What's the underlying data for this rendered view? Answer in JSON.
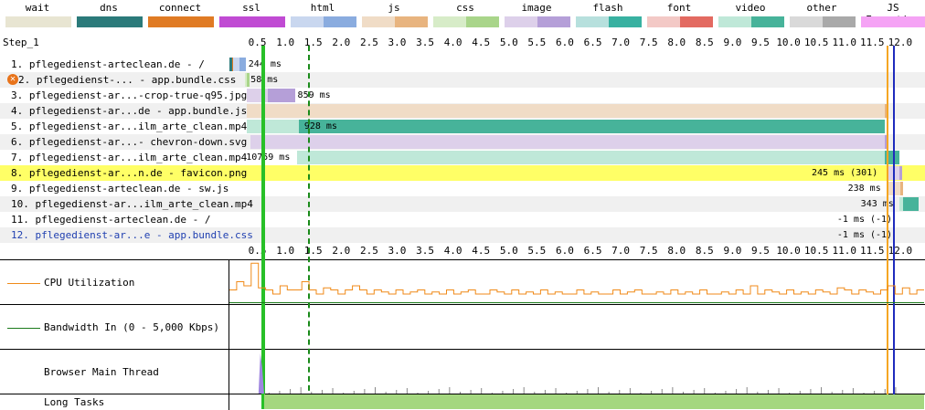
{
  "legend": [
    {
      "label": "wait",
      "c1": "#e8e5d2",
      "c2": "#e8e5d2"
    },
    {
      "label": "dns",
      "c1": "#2b7a7a",
      "c2": "#2b7a7a"
    },
    {
      "label": "connect",
      "c1": "#e07b24",
      "c2": "#e07b24"
    },
    {
      "label": "ssl",
      "c1": "#c04bd3",
      "c2": "#c04bd3"
    },
    {
      "label": "html",
      "c1": "#c9d7ef",
      "c2": "#8aacdf"
    },
    {
      "label": "js",
      "c1": "#f0dcc6",
      "c2": "#e8b47f"
    },
    {
      "label": "css",
      "c1": "#d7ecc8",
      "c2": "#a9d58a"
    },
    {
      "label": "image",
      "c1": "#ddd0ea",
      "c2": "#b59fd8"
    },
    {
      "label": "flash",
      "c1": "#b7e0dd",
      "c2": "#38b1a1"
    },
    {
      "label": "font",
      "c1": "#f3c9c6",
      "c2": "#e36a61"
    },
    {
      "label": "video",
      "c1": "#bfe8d8",
      "c2": "#47b39a"
    },
    {
      "label": "other",
      "c1": "#d9d9d9",
      "c2": "#a9a9a9"
    },
    {
      "label": "JS Execution",
      "c1": "#f5a3f5",
      "c2": "#f5a3f5"
    }
  ],
  "step_label": "Step_1",
  "chart_data": {
    "type": "waterfall",
    "xlim": [
      0,
      12.1
    ],
    "x_ticks": [
      "0.5",
      "1.0",
      "1.5",
      "2.0",
      "2.5",
      "3.0",
      "3.5",
      "4.0",
      "4.5",
      "5.0",
      "5.5",
      "6.0",
      "6.5",
      "7.0",
      "7.5",
      "8.0",
      "8.5",
      "9.0",
      "9.5",
      "10.0",
      "10.5",
      "11.0",
      "11.5",
      "12.0"
    ],
    "requests": [
      {
        "label": "1. pflegedienst-arteclean.de - /",
        "start": 0.06,
        "ttfb_end": 0.18,
        "end": 0.29,
        "c1": "#c9d7ef",
        "c2": "#8aacdf",
        "pre": [
          {
            "s": 0.0,
            "e": 0.05,
            "c": "#2b7a7a"
          },
          {
            "s": 0.05,
            "e": 0.1,
            "c": "#e07b24"
          },
          {
            "s": 0.1,
            "e": 0.16,
            "c": "#c04bd3"
          }
        ],
        "ms": "244 ms",
        "ms_side": "right",
        "blue": false,
        "highlight": false,
        "error": false
      },
      {
        "label": "2. pflegedienst-... - app.bundle.css",
        "start": 0.27,
        "ttfb_end": 0.31,
        "end": 0.33,
        "c1": "#d7ecc8",
        "c2": "#a9d58a",
        "pre": [],
        "ms": "58 ms",
        "ms_side": "right",
        "blue": false,
        "highlight": false,
        "error": true
      },
      {
        "label": "3. pflegedienst-ar...-crop-true-q95.jpg",
        "start": 0.31,
        "ttfb_end": 0.68,
        "end": 1.17,
        "c1": "#ddd0ea",
        "c2": "#b59fd8",
        "pre": [],
        "ms": "859 ms",
        "ms_side": "right",
        "blue": false,
        "highlight": false,
        "error": false
      },
      {
        "label": "4. pflegedienst-ar...de - app.bundle.js",
        "start": 0.31,
        "ttfb_end": 11.73,
        "end": 11.73,
        "c1": "#f0dcc6",
        "c2": "#e8b47f",
        "pre": [],
        "ms": "",
        "ms_side": "none",
        "blue": false,
        "highlight": false,
        "error": false
      },
      {
        "label": "5. pflegedienst-ar...ilm_arte_clean.mp4",
        "start": 0.31,
        "ttfb_end": 1.24,
        "end": 11.73,
        "c1": "#bfe8d8",
        "c2": "#47b39a",
        "pre": [],
        "ms": "928 ms",
        "ms_side": "inside",
        "blue": false,
        "highlight": false,
        "error": false
      },
      {
        "label": "6. pflegedienst-ar...- chevron-down.svg",
        "start": 0.38,
        "ttfb_end": 11.73,
        "end": 11.73,
        "c1": "#ddd0ea",
        "c2": "#b59fd8",
        "pre": [],
        "ms": "",
        "ms_side": "none",
        "blue": false,
        "highlight": false,
        "error": false
      },
      {
        "label": "7. pflegedienst-ar...ilm_arte_clean.mp4",
        "start": 1.21,
        "ttfb_end": 11.73,
        "end": 11.99,
        "c1": "#bfe8d8",
        "c2": "#47b39a",
        "pre": [],
        "ms": "10759 ms",
        "ms_side": "left",
        "blue": false,
        "highlight": false,
        "error": false
      },
      {
        "label": "8. pflegedienst-ar...n.de - favicon.png",
        "start": 11.76,
        "ttfb_end": 11.99,
        "end": 11.99,
        "c1": "#ddd0ea",
        "c2": "#b59fd8",
        "pre": [],
        "ms": "245 ms (301)",
        "ms_side": "left",
        "blue": false,
        "highlight": true,
        "error": false
      },
      {
        "label": "9. pflegedienst-arteclean.de - sw.js",
        "start": 11.76,
        "ttfb_end": 12.0,
        "end": 12.0,
        "c1": "#f0dcc6",
        "c2": "#e8b47f",
        "pre": [],
        "ms": "238 ms",
        "ms_side": "left",
        "blue": false,
        "highlight": false,
        "error": false
      },
      {
        "label": "10. pflegedienst-ar...ilm_arte_clean.mp4",
        "start": 11.99,
        "ttfb_end": 12.05,
        "end": 12.33,
        "c1": "#bfe8d8",
        "c2": "#47b39a",
        "pre": [],
        "ms": "343 ms",
        "ms_side": "left",
        "blue": false,
        "highlight": false,
        "error": false
      },
      {
        "label": "11. pflegedienst-arteclean.de - /",
        "start": 12.0,
        "ttfb_end": 12.0,
        "end": 12.0,
        "c1": "#c9d7ef",
        "c2": "#8aacdf",
        "pre": [],
        "ms": "-1 ms (-1)",
        "ms_side": "left",
        "blue": false,
        "highlight": false,
        "error": false
      },
      {
        "label": "12. pflegedienst-ar...e - app.bundle.css",
        "start": 12.0,
        "ttfb_end": 12.0,
        "end": 12.0,
        "c1": "#d7ecc8",
        "c2": "#a9d58a",
        "pre": [],
        "ms": "-1 ms (-1)",
        "ms_side": "left",
        "blue": true,
        "highlight": false,
        "error": false
      }
    ],
    "markers": [
      {
        "name": "start-render",
        "t": 0.58,
        "color": "#28c028"
      },
      {
        "name": "dom-content-loaded",
        "t": 0.61,
        "color": "#28c028"
      },
      {
        "name": "lcp",
        "t": 1.41,
        "color": "#1a8a1a"
      },
      {
        "name": "on-load",
        "t": 11.76,
        "color": "#f5a623"
      },
      {
        "name": "document-complete",
        "t": 11.87,
        "color": "#1f2bbd"
      }
    ],
    "panels": [
      {
        "label": "CPU Utilization",
        "legend_color": "#f08a18"
      },
      {
        "label": "Bandwidth In (0 - 5,000 Kbps)",
        "legend_color": "#1a7a1a"
      },
      {
        "label": "Browser Main Thread",
        "legend_color": ""
      },
      {
        "label": "Long Tasks",
        "legend_color": ""
      }
    ],
    "cpu": [
      0.3,
      0.5,
      0.4,
      0.95,
      0.35,
      0.3,
      0.2,
      0.4,
      0.3,
      0.3,
      0.5,
      0.3,
      0.2,
      0.35,
      0.3,
      0.2,
      0.3,
      0.4,
      0.3,
      0.2,
      0.3,
      0.25,
      0.2,
      0.3,
      0.2,
      0.25,
      0.3,
      0.2,
      0.25,
      0.2,
      0.3,
      0.2,
      0.25,
      0.3,
      0.2,
      0.2,
      0.3,
      0.25,
      0.2,
      0.3,
      0.2,
      0.25,
      0.2,
      0.3,
      0.2,
      0.25,
      0.2,
      0.2,
      0.3,
      0.2,
      0.25,
      0.2,
      0.2,
      0.3,
      0.2,
      0.25,
      0.3,
      0.2,
      0.2,
      0.25,
      0.2,
      0.3,
      0.2,
      0.25,
      0.2,
      0.3,
      0.2,
      0.2,
      0.25,
      0.2,
      0.3,
      0.2,
      0.4,
      0.2,
      0.3,
      0.25,
      0.2,
      0.3,
      0.2,
      0.25,
      0.2,
      0.3,
      0.25,
      0.2,
      0.35,
      0.3,
      0.2,
      0.3,
      0.25,
      0.2,
      0.3,
      0.4,
      0.2,
      0.35,
      0.2,
      0.3
    ],
    "long_task_start": 0.62
  }
}
